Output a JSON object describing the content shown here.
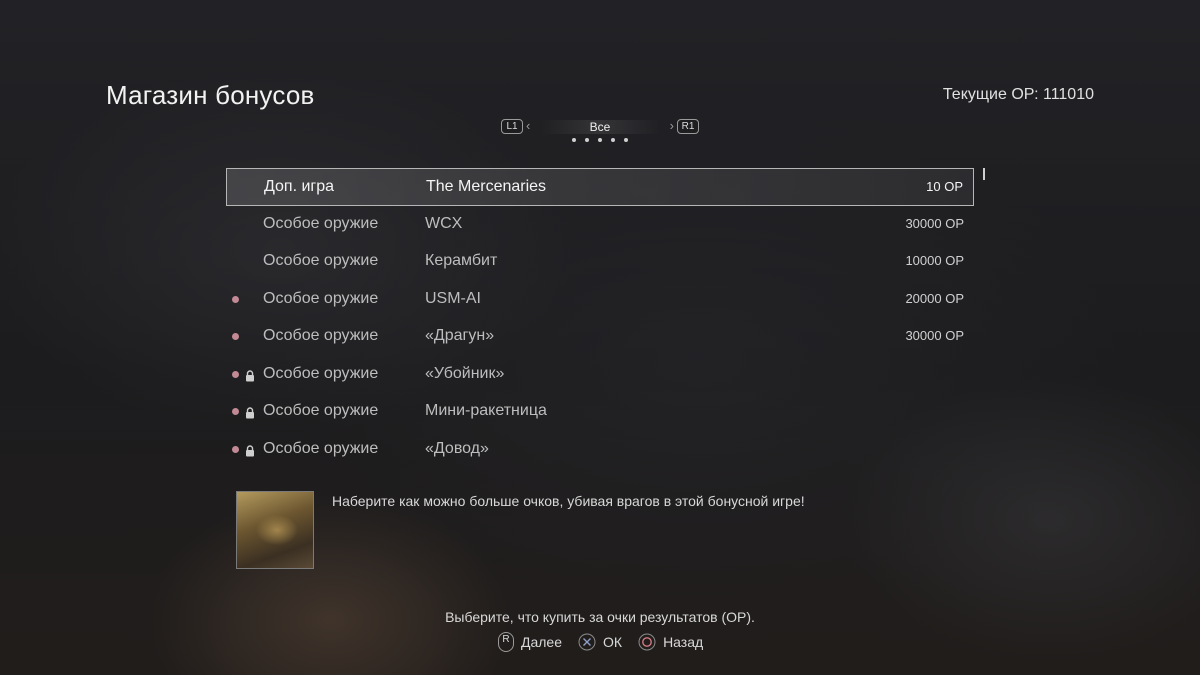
{
  "header": {
    "title": "Магазин бонусов",
    "points_label": "Текущие ОР: 111010"
  },
  "tabs": {
    "left_button": "L1",
    "right_button": "R1",
    "current": "Все",
    "page_count": 5
  },
  "items": [
    {
      "category": "Доп. игра",
      "name": "The Mercenaries",
      "price": "10 ОР",
      "selected": true,
      "new": false,
      "locked": false
    },
    {
      "category": "Особое оружие",
      "name": "WCX",
      "price": "30000 ОР",
      "selected": false,
      "new": false,
      "locked": false
    },
    {
      "category": "Особое оружие",
      "name": "Керамбит",
      "price": "10000 ОР",
      "selected": false,
      "new": false,
      "locked": false
    },
    {
      "category": "Особое оружие",
      "name": "USM-AI",
      "price": "20000 ОР",
      "selected": false,
      "new": true,
      "locked": false
    },
    {
      "category": "Особое оружие",
      "name": "«Драгун»",
      "price": "30000 ОР",
      "selected": false,
      "new": true,
      "locked": false
    },
    {
      "category": "Особое оружие",
      "name": "«Убойник»",
      "price": "",
      "selected": false,
      "new": true,
      "locked": true
    },
    {
      "category": "Особое оружие",
      "name": "Мини-ракетница",
      "price": "",
      "selected": false,
      "new": true,
      "locked": true
    },
    {
      "category": "Особое оружие",
      "name": "«Довод»",
      "price": "",
      "selected": false,
      "new": true,
      "locked": true
    }
  ],
  "detail": {
    "description": "Наберите как можно больше очков, убивая врагов в этой бонусной игре!"
  },
  "footer": {
    "hint": "Выберите, что купить за очки результатов (ОР).",
    "controls": [
      {
        "icon": "right-stick-icon",
        "glyph": "R",
        "label": "Далее"
      },
      {
        "icon": "cross-button-icon",
        "glyph": "",
        "label": "ОК"
      },
      {
        "icon": "circle-button-icon",
        "glyph": "",
        "label": "Назад"
      }
    ]
  },
  "colors": {
    "new_dot": "#c28a94",
    "selected_border": "#b6b6b6",
    "text_dim": "#bdbdbd"
  }
}
